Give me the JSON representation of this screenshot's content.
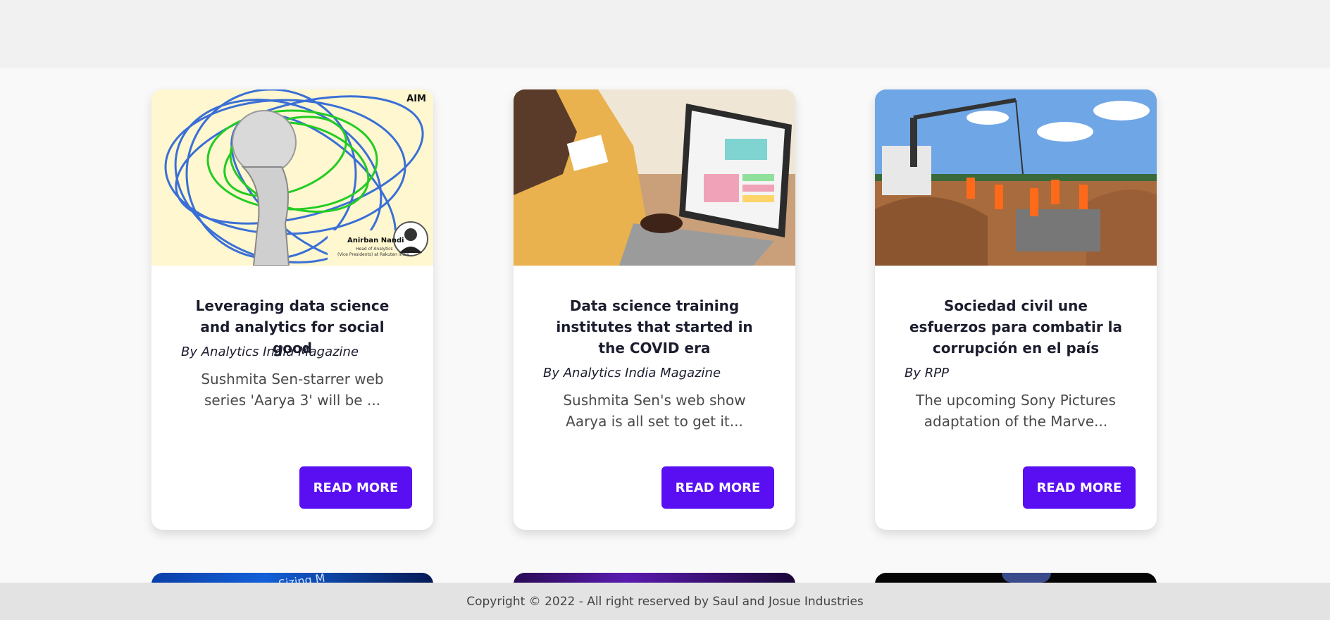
{
  "cards": [
    {
      "title": "Leveraging data science and analytics for social good",
      "author": "By Analytics India Magazine",
      "excerpt": "Sushmita Sen-starrer web series 'Aarya 3' will be ...",
      "button": "READ MORE",
      "image_caption": {
        "name": "Anirban Nandi",
        "role": "Head of Analytics",
        "org": "(Vice Presidents) at Rakuten India",
        "logo": "AIM"
      }
    },
    {
      "title": "Data science training institutes that started in the COVID era",
      "author": "By Analytics India Magazine",
      "excerpt": "Sushmita Sen's web show Aarya is all set to get it...",
      "button": "READ MORE"
    },
    {
      "title": "Sociedad civil une esfuerzos para combatir la corrupción en el país",
      "author": "By RPP",
      "excerpt": "The upcoming Sony Pictures adaptation of the Marve...",
      "button": "READ MORE"
    }
  ],
  "peek_cards": [
    {
      "image_text": "Sizing M"
    },
    {
      "image_text": ""
    },
    {
      "image_text": ""
    }
  ],
  "footer": {
    "copyright": "Copyright © 2022 - All right reserved by Saul and Josue Industries"
  },
  "colors": {
    "accent": "#5a0ff2",
    "footer_bg": "#e3e3e3",
    "topbar_bg": "#f1f1f1"
  }
}
